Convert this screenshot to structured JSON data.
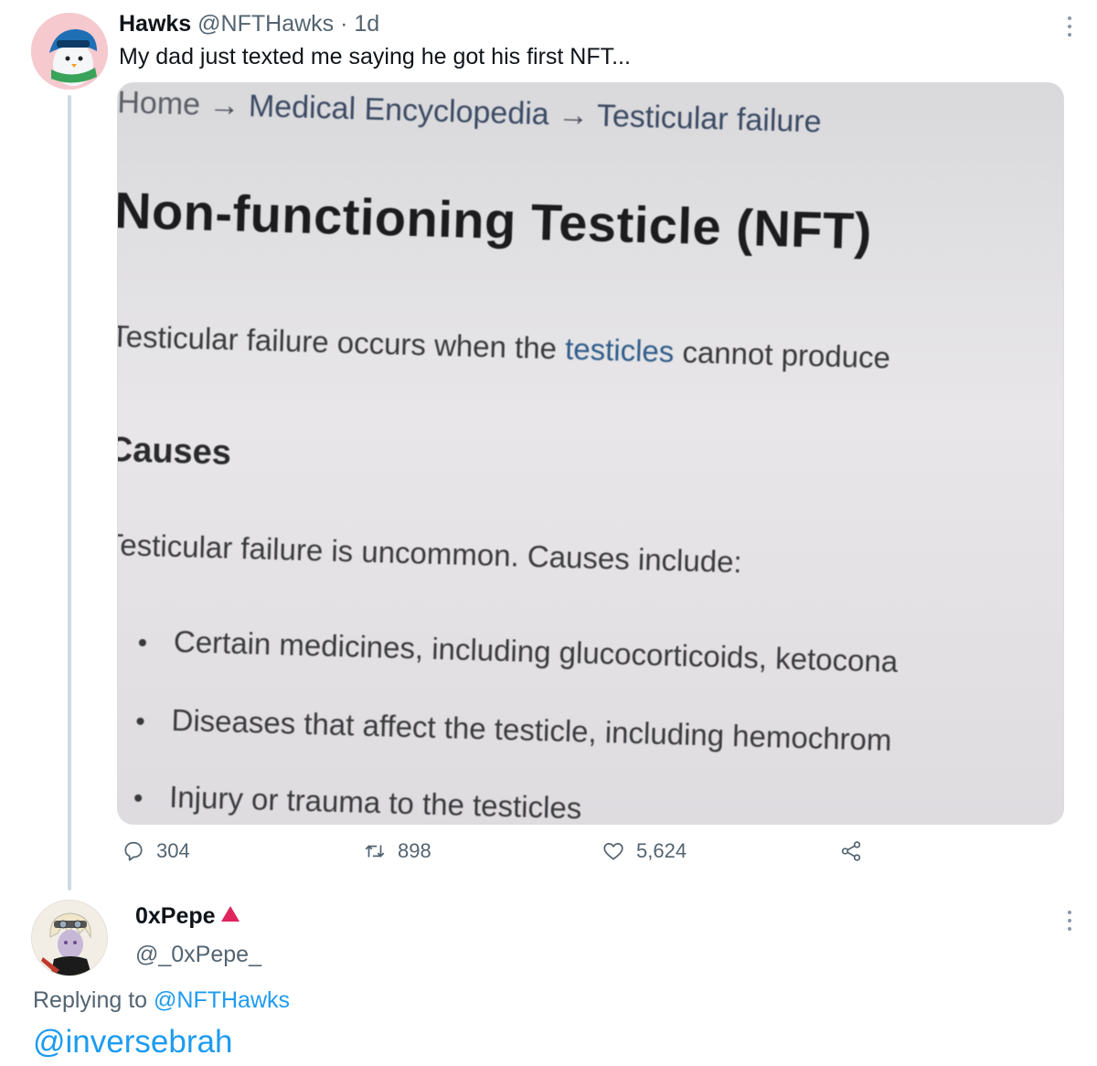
{
  "tweet": {
    "author_name": "Hawks",
    "author_handle": "@NFTHawks",
    "separator": "·",
    "time": "1d",
    "text": "My dad just texted me saying he got his first NFT...",
    "photo": {
      "breadcrumb_home": "Home",
      "breadcrumb_arrow": "→",
      "breadcrumb_section": "Medical Encyclopedia",
      "breadcrumb_page": "Testicular failure",
      "title": "Non-functioning Testicle (NFT)",
      "intro_start": "Testicular failure occurs when the ",
      "intro_link": "testicles",
      "intro_end": " cannot produce",
      "heading": "Causes",
      "paragraph": "Testicular failure is uncommon. Causes include:",
      "bullets": [
        "Certain medicines, including glucocorticoids, ketocona",
        "Diseases that affect the testicle, including hemochrom",
        "Injury or trauma to the testicles"
      ]
    },
    "actions": {
      "replies": "304",
      "retweets": "898",
      "likes": "5,624"
    }
  },
  "reply": {
    "author_name": "0xPepe",
    "author_handle": "@_0xPepe_",
    "replying_prefix": "Replying to ",
    "replying_to": "@NFTHawks",
    "text": "@inversebrah"
  },
  "colors": {
    "link": "#1d9bf0",
    "secondary_text": "#536471",
    "verified_badge": "#e0245e"
  },
  "icons": {
    "reply": "comment-bubble-icon",
    "retweet": "retweet-arrows-icon",
    "like": "heart-icon",
    "share": "share-nodes-icon",
    "more": "vertical-dots-icon"
  }
}
